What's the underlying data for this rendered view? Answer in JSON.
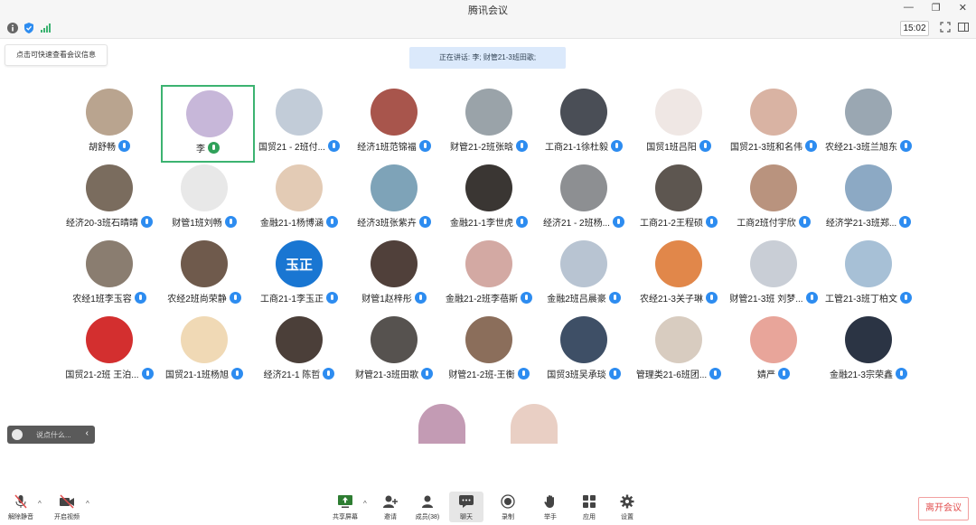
{
  "window": {
    "title": "腾讯会议"
  },
  "topbar": {
    "time": "15:02"
  },
  "meeting_info_tip": "点击可快速查看会议信息",
  "speaking_banner": "正在讲话: 李; 财管21-3班田歌;",
  "participants": [
    {
      "name": "胡舒畅",
      "active": false
    },
    {
      "name": "李",
      "active": true
    },
    {
      "name": "国贸21 - 2班付...",
      "active": false
    },
    {
      "name": "经济1班范锦福",
      "active": false
    },
    {
      "name": "财管21-2班张晗",
      "active": false
    },
    {
      "name": "工商21-1徐杜毅",
      "active": false
    },
    {
      "name": "国贸1班吕阳",
      "active": false
    },
    {
      "name": "国贸21-3班和名伟",
      "active": false
    },
    {
      "name": "农经21-3班兰旭东",
      "active": false
    },
    {
      "name": "经济20-3班石晴晴",
      "active": false
    },
    {
      "name": "财管1班刘畅",
      "active": false
    },
    {
      "name": "金融21-1杨博涵",
      "active": false
    },
    {
      "name": "经济3班张紫卉",
      "active": false
    },
    {
      "name": "金融21-1李世虎",
      "active": false
    },
    {
      "name": "经济21 - 2班杨...",
      "active": false
    },
    {
      "name": "工商21-2王程硕",
      "active": false
    },
    {
      "name": "工商2班付宇欣",
      "active": false
    },
    {
      "name": "经济学21-3班郑...",
      "active": false
    },
    {
      "name": "农经1班李玉容",
      "active": false
    },
    {
      "name": "农经2班尚荣静",
      "active": false
    },
    {
      "name": "工商21-1李玉正",
      "active": false
    },
    {
      "name": "财管1赵梓彤",
      "active": false
    },
    {
      "name": "金融21-2班李蓓斯",
      "active": false
    },
    {
      "name": "金融2班吕晨豪",
      "active": false
    },
    {
      "name": "农经21-3关子琳",
      "active": false
    },
    {
      "name": "财管21-3班 刘梦...",
      "active": false
    },
    {
      "name": "工管21-3班丁柏文",
      "active": false
    },
    {
      "name": "国贸21-2班 王泊...",
      "active": false
    },
    {
      "name": "国贸21-1班杨旭",
      "active": false
    },
    {
      "name": "经济21-1 陈哲",
      "active": false
    },
    {
      "name": "财管21-3班田歌",
      "active": false
    },
    {
      "name": "财管21-2班-王衡",
      "active": false
    },
    {
      "name": "国贸3班吴承琰",
      "active": false
    },
    {
      "name": "管理类21-6班团...",
      "active": false
    },
    {
      "name": "婧严",
      "active": false
    },
    {
      "name": "金融21-3宗荣鑫",
      "active": false
    },
    {
      "name": "",
      "active": false
    },
    {
      "name": "",
      "active": false
    }
  ],
  "avatar_text": {
    "yuzheng": "玉正"
  },
  "colors": {
    "accent": "#2d8cf0",
    "active_border": "#3cb371",
    "speaking_bg": "#dbe9fb",
    "leave": "#e24d4d"
  },
  "chat": {
    "placeholder": "说点什么..."
  },
  "toolbar": {
    "unmute": "解除静音",
    "start_video": "开启视频",
    "share_screen": "共享屏幕",
    "invite": "邀请",
    "members": "成员(38)",
    "chat": "聊天",
    "record": "录制",
    "raise_hand": "举手",
    "apps": "应用",
    "settings": "设置",
    "leave": "离开会议"
  }
}
